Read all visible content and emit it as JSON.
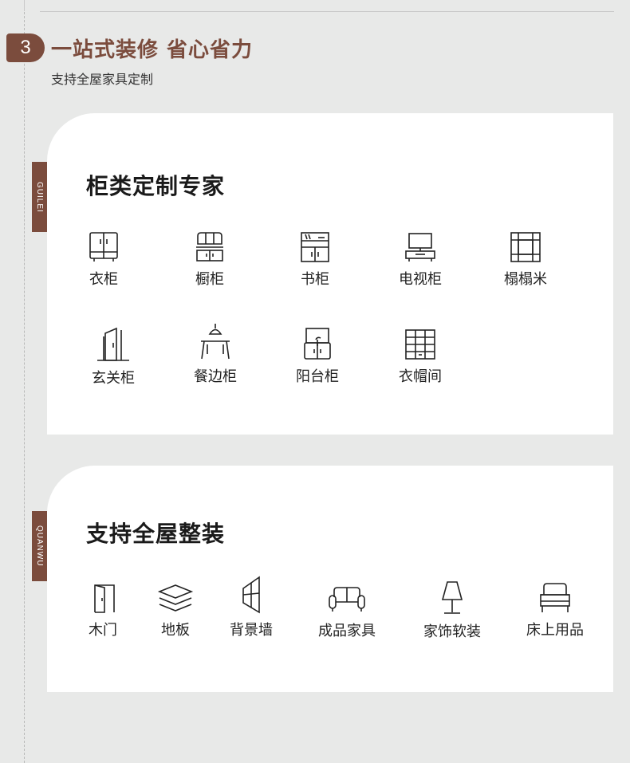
{
  "section": {
    "number": "3",
    "title": "一站式装修 省心省力",
    "subtitle": "支持全屋家具定制"
  },
  "panels": [
    {
      "tab": "GUILEI",
      "title": "柜类定制专家",
      "items": [
        {
          "label": "衣柜",
          "icon": "wardrobe-icon"
        },
        {
          "label": "橱柜",
          "icon": "kitchen-cabinet-icon"
        },
        {
          "label": "书柜",
          "icon": "bookcase-icon"
        },
        {
          "label": "电视柜",
          "icon": "tv-cabinet-icon"
        },
        {
          "label": "榻榻米",
          "icon": "tatami-icon"
        },
        {
          "label": "玄关柜",
          "icon": "entry-cabinet-icon"
        },
        {
          "label": "餐边柜",
          "icon": "sideboard-icon"
        },
        {
          "label": "阳台柜",
          "icon": "balcony-cabinet-icon"
        },
        {
          "label": "衣帽间",
          "icon": "cloakroom-icon"
        }
      ]
    },
    {
      "tab": "QUANWU",
      "title": "支持全屋整装",
      "items": [
        {
          "label": "木门",
          "icon": "door-icon"
        },
        {
          "label": "地板",
          "icon": "flooring-icon"
        },
        {
          "label": "背景墙",
          "icon": "feature-wall-icon"
        },
        {
          "label": "成品家具",
          "icon": "sofa-icon"
        },
        {
          "label": "家饰软装",
          "icon": "lamp-icon"
        },
        {
          "label": "床上用品",
          "icon": "bed-icon"
        }
      ]
    }
  ],
  "colors": {
    "accent": "#7b4c3d",
    "background": "#e8e9e8",
    "panel": "#ffffff"
  }
}
